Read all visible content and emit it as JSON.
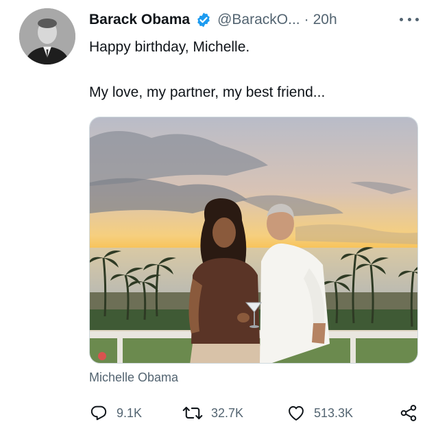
{
  "tweet": {
    "author_name": "Barack Obama",
    "handle": "@BarackO...",
    "separator": "·",
    "time": "20h",
    "text": "Happy birthday, Michelle.\n\nMy love, my partner, my best friend...",
    "media_caption": "Michelle Obama",
    "verified_color": "#1d9bf0"
  },
  "icons": {
    "more": "more-horizontal-icon",
    "verified": "verified-badge-icon",
    "reply": "reply-icon",
    "retweet": "retweet-icon",
    "like": "heart-icon",
    "share": "share-icon"
  },
  "actions": {
    "replies": "9.1K",
    "retweets": "32.7K",
    "likes": "513.3K"
  }
}
